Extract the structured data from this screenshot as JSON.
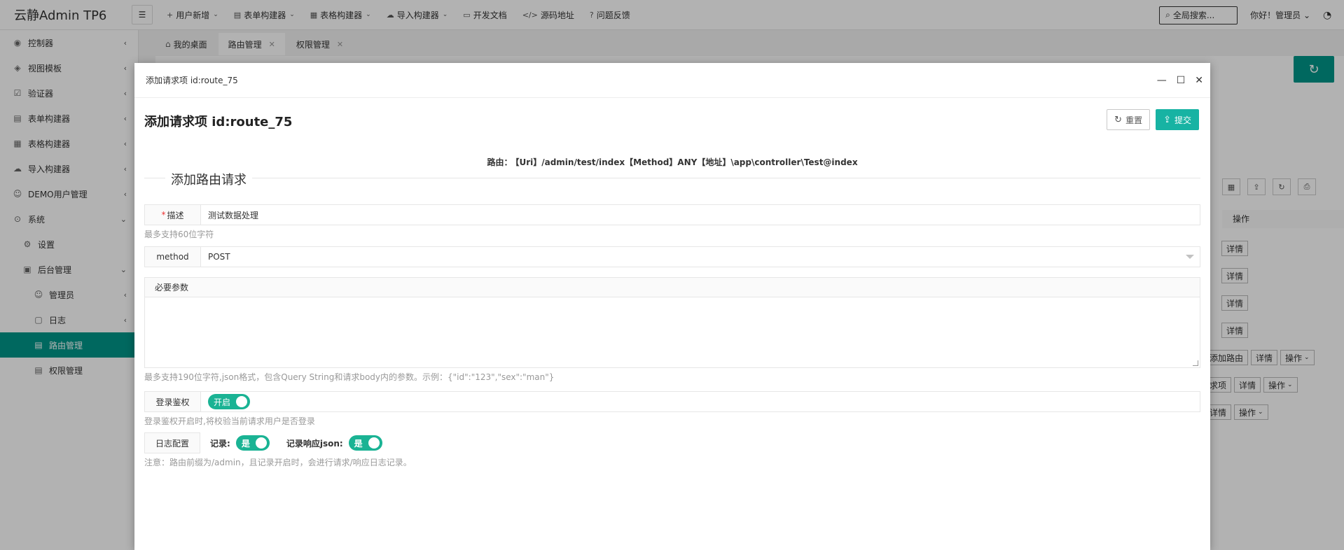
{
  "app": {
    "logo": "云静Admin TP6"
  },
  "topnav": [
    {
      "icon": "+",
      "label": "用户新增",
      "caret": true
    },
    {
      "icon": "▤",
      "label": "表单构建器",
      "caret": true
    },
    {
      "icon": "▦",
      "label": "表格构建器",
      "caret": true
    },
    {
      "icon": "☁",
      "label": "导入构建器",
      "caret": true
    },
    {
      "icon": "▭",
      "label": "开发文档",
      "caret": false
    },
    {
      "icon": "</>",
      "label": "源码地址",
      "caret": false
    },
    {
      "icon": "?",
      "label": "问题反馈",
      "caret": false
    }
  ],
  "search": {
    "placeholder": "全局搜索..."
  },
  "user": {
    "greeting": "你好！管理员"
  },
  "sidebar": {
    "items": [
      {
        "label": "控制器",
        "icon": "◉"
      },
      {
        "label": "视图模板",
        "icon": "◈"
      },
      {
        "label": "验证器",
        "icon": "☑"
      },
      {
        "label": "表单构建器",
        "icon": "▤"
      },
      {
        "label": "表格构建器",
        "icon": "▦"
      },
      {
        "label": "导入构建器",
        "icon": "☁"
      },
      {
        "label": "DEMO用户管理",
        "icon": "☺"
      },
      {
        "label": "系统",
        "icon": "⊙"
      },
      {
        "label": "设置",
        "icon": "⚙"
      },
      {
        "label": "后台管理",
        "icon": "▣"
      },
      {
        "label": "管理员",
        "icon": "☺"
      },
      {
        "label": "日志",
        "icon": "▢"
      },
      {
        "label": "路由管理",
        "icon": "▤"
      },
      {
        "label": "权限管理",
        "icon": "▤"
      }
    ]
  },
  "tabs": [
    {
      "label": "我的桌面"
    },
    {
      "label": "路由管理"
    },
    {
      "label": "权限管理"
    }
  ],
  "background": {
    "op_header": "操作",
    "rows": [
      {
        "buttons": [
          "详情"
        ]
      },
      {
        "buttons": [
          "详情"
        ]
      },
      {
        "buttons": [
          "详情"
        ]
      },
      {
        "buttons": [
          "详情"
        ]
      },
      {
        "buttons": [
          "添加路由",
          "详情",
          "操作"
        ]
      },
      {
        "buttons": [
          "求项",
          "详情",
          "操作"
        ]
      },
      {
        "buttons": [
          "详情",
          "操作"
        ]
      }
    ]
  },
  "modal": {
    "window_title": "添加请求项 id:route_75",
    "page_title": "添加请求项 id:route_75",
    "reset_label": "重置",
    "submit_label": "提交",
    "route_label": "路由：",
    "route_value": "【Uri】/admin/test/index【Method】ANY【地址】\\app\\controller\\Test@index",
    "section_title": "添加路由请求",
    "desc": {
      "label": "描述",
      "value": "测试数据处理",
      "hint": "最多支持60位字符"
    },
    "method": {
      "label": "method",
      "value": "POST"
    },
    "params": {
      "label": "必要参数",
      "hint": "最多支持190位字符,json格式，包含Query String和请求body内的参数。示例：{\"id\":\"123\",\"sex\":\"man\"}"
    },
    "auth": {
      "label": "登录鉴权",
      "switch_text": "开启",
      "hint": "登录鉴权开启时,将校验当前请求用户是否登录"
    },
    "log": {
      "label": "日志配置",
      "record_label": "记录:",
      "record_value": "是",
      "record_json_label": "记录响应json:",
      "record_json_value": "是",
      "note": "注意：路由前缀为/admin，且记录开启时，会进行请求/响应日志记录。"
    }
  }
}
